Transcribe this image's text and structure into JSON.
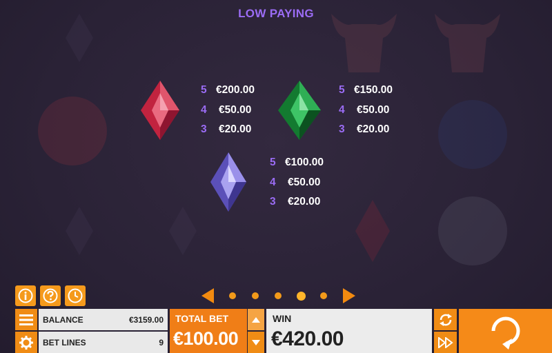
{
  "header": {
    "title": "LOW PAYING"
  },
  "paytables": [
    {
      "gem": "red-gem-icon",
      "color": "#d8334f",
      "rows": [
        {
          "count": "5",
          "amount": "€200.00"
        },
        {
          "count": "4",
          "amount": "€50.00"
        },
        {
          "count": "3",
          "amount": "€20.00"
        }
      ]
    },
    {
      "gem": "green-gem-icon",
      "color": "#1f9a3d",
      "rows": [
        {
          "count": "5",
          "amount": "€150.00"
        },
        {
          "count": "4",
          "amount": "€50.00"
        },
        {
          "count": "3",
          "amount": "€20.00"
        }
      ]
    },
    {
      "gem": "purple-gem-icon",
      "color": "#7b6fd8",
      "rows": [
        {
          "count": "5",
          "amount": "€100.00"
        },
        {
          "count": "4",
          "amount": "€50.00"
        },
        {
          "count": "3",
          "amount": "€20.00"
        }
      ]
    }
  ],
  "pager": {
    "pages": 5,
    "active_page": 4
  },
  "bottom_bar": {
    "balance_label": "BALANCE",
    "balance_value": "€3159.00",
    "bet_lines_label": "BET LINES",
    "bet_lines_value": "9",
    "total_bet_label": "TOTAL BET",
    "total_bet_value": "€100.00",
    "win_label": "WIN",
    "win_value": "€420.00"
  },
  "colors": {
    "accent": "#f08c15",
    "text_purple": "#9b6cf5",
    "background": "#2a2236"
  }
}
